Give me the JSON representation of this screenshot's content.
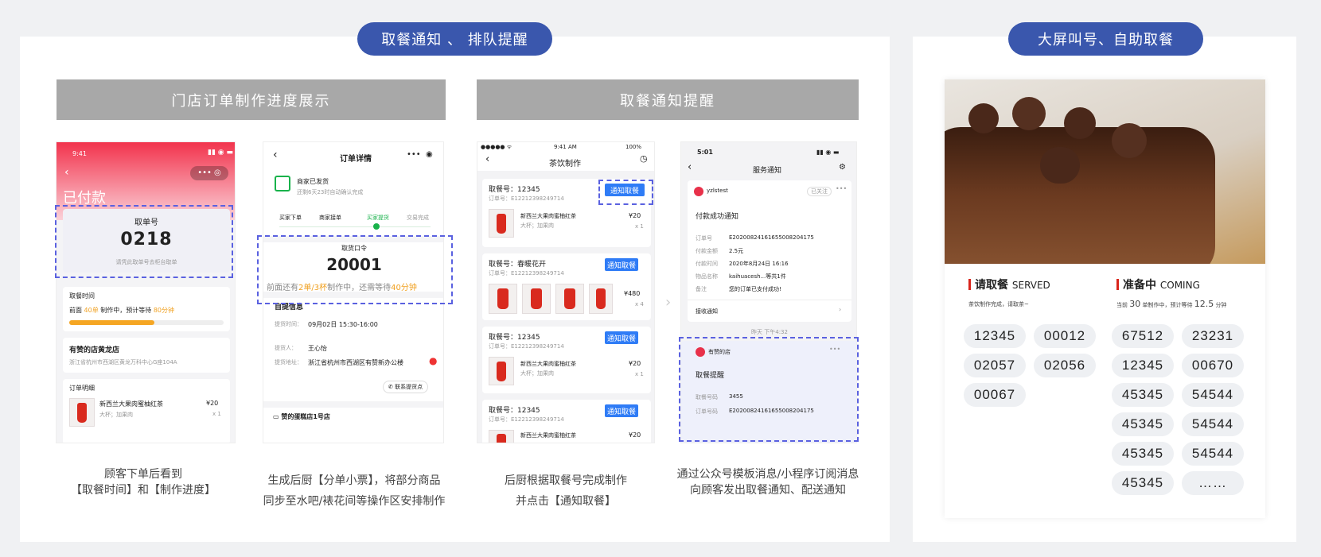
{
  "left_section": {
    "header_pill": "取餐通知 、 排队提醒"
  },
  "right_section": {
    "header_pill": "大屏叫号、自助取餐"
  },
  "group_headers": {
    "progress": "门店订单制作进度展示",
    "pickup": "取餐通知提醒"
  },
  "captions": {
    "c1_line1": "顾客下单后看到",
    "c1_line2": "【取餐时间】和【制作进度】",
    "c2_line1": "生成后厨【分单小票】，将部分商品",
    "c2_line2": "同步至水吧/裱花间等操作区安排制作",
    "c3_line1": "后厨根据取餐号完成制作",
    "c3_line2": "并点击【通知取餐】",
    "c4_line1": "通过公众号模板消息/小程序订阅消息",
    "c4_line2": "向顾客发出取餐通知、配送通知"
  },
  "phone1": {
    "time": "9:41",
    "status_title": "已付款",
    "pickup_label": "取单号",
    "pickup_number": "0218",
    "pickup_hint": "请凭此取单号去柜台取单",
    "pickup_time_label": "取餐时间",
    "queue_prefix": "前面",
    "queue_count": "40单",
    "queue_mid": "制作中，预计等待",
    "queue_wait": "80分钟",
    "progress": 0.55,
    "store_name": "有赞的店黄龙店",
    "store_address": "浙江省杭州市西湖区黄龙万科中心G座104A",
    "order_detail_label": "订单明细",
    "item_name": "新西兰大果肉蜜柚红茶",
    "item_spec": "大杯；加果肉",
    "item_price": "¥20",
    "item_qty": "x 1"
  },
  "phone2": {
    "title": "订单详情",
    "shipped": "商家已发货",
    "auto_confirm": "还剩6天23时自动确认完成",
    "steps": [
      "买家下单",
      "商家接单",
      "买家提货",
      "交易完成"
    ],
    "pickup_code_label": "取货口令",
    "pickup_code": "20001",
    "queue_prefix": "前面还有",
    "queue_a": "2单/3杯",
    "queue_mid": "制作中，还需等待",
    "queue_wait": "40分钟",
    "pickup_info_label": "自提信息",
    "time_label": "提货时间：",
    "time_value": "09月02日 15:30-16:00",
    "person_label": "提货人：",
    "person_value": "王心怡",
    "addr_label": "提货地址：",
    "addr_value": "浙江省杭州市西湖区有赞新办公楼",
    "contact_btn": "联系提货点",
    "shop_name": "赞的蛋糕店1号店"
  },
  "phone3": {
    "time": "9:41 AM",
    "battery": "100%",
    "title": "茶饮制作",
    "notify_btn": "通知取餐",
    "orders": [
      {
        "no": "取餐号：12345",
        "sub": "订单号：E12212398249714",
        "item": "新西兰大果肉蜜柚红茶",
        "spec": "大杯；加果肉",
        "price": "¥20",
        "qty": "x 1"
      },
      {
        "no": "取餐号：春暖花开",
        "sub": "订单号：E12212398249714",
        "price": "¥480",
        "qty": "x 4"
      },
      {
        "no": "取餐号：12345",
        "sub": "订单号：E12212398249714",
        "item": "新西兰大果肉蜜柚红茶",
        "spec": "大杯；加果肉",
        "price": "¥20",
        "qty": "x 1"
      },
      {
        "no": "取餐号：12345",
        "sub": "订单号：E12212398249714",
        "item": "新西兰大果肉蜜柚红茶",
        "price": "¥20"
      }
    ]
  },
  "phone4": {
    "time": "5:01",
    "title": "服务通知",
    "sender": "yzlstest",
    "followed": "已关注",
    "msg_title": "付款成功通知",
    "rows": [
      {
        "k": "订单号",
        "v": "E20200824161655008204175"
      },
      {
        "k": "付款金额",
        "v": "2.5元"
      },
      {
        "k": "付款时间",
        "v": "2020年8月24日 16:16"
      },
      {
        "k": "物品名称",
        "v": "kaihuacesh...等共1件"
      },
      {
        "k": "备注",
        "v": "您的订单已支付成功!"
      }
    ],
    "receive": "接收通知",
    "timestamp": "昨天 下午4:32",
    "sender2": "有赞的店",
    "msg2_title": "取餐提醒",
    "rows2": [
      {
        "k": "取餐号码",
        "v": "3455"
      },
      {
        "k": "订单号码",
        "v": "E20200824161655008204175"
      }
    ]
  },
  "big_screen": {
    "served_cn": "请取餐",
    "served_en": "SERVED",
    "served_sub": "茶饮制作完成，请取茶~",
    "coming_cn": "准备中",
    "coming_en": "COMING",
    "coming_pre": "当前",
    "coming_count": "30",
    "coming_mid": "单制作中，预计等待",
    "coming_wait": "12.5",
    "coming_unit": "分钟",
    "served_numbers": [
      "12345",
      "00012",
      "02057",
      "02056",
      "00067"
    ],
    "coming_numbers": [
      "67512",
      "23231",
      "12345",
      "00670",
      "45345",
      "54544",
      "45345",
      "54544",
      "45345",
      "54544",
      "45345",
      "……"
    ]
  },
  "colors": {
    "accent": "#3a57ad",
    "brand_red": "#e8314a",
    "dash": "#5a61e0",
    "notify_blue": "#2f7cf6"
  }
}
